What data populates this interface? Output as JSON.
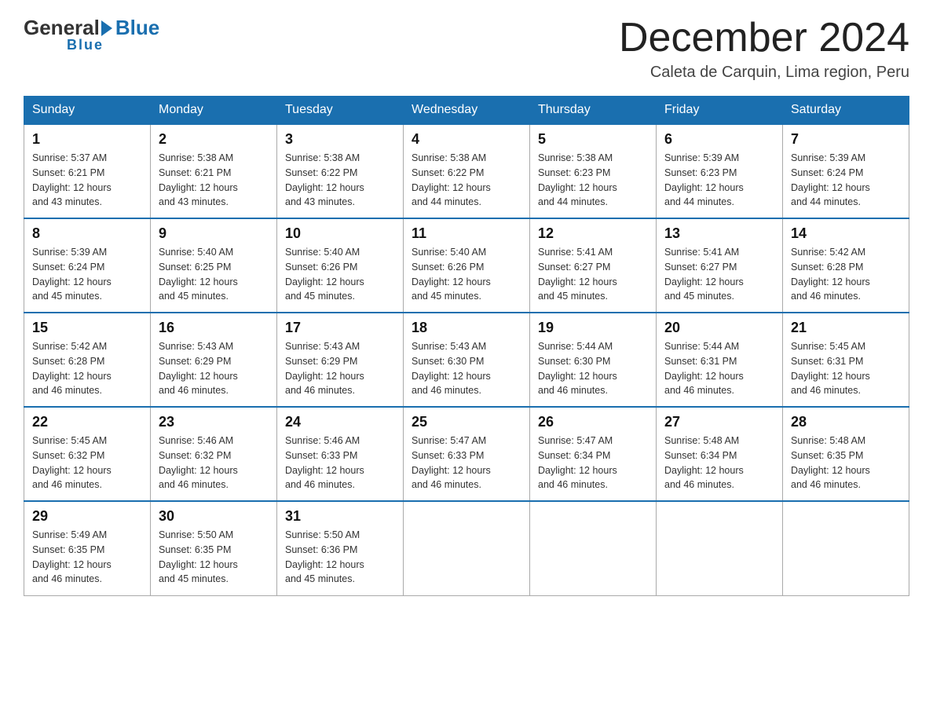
{
  "header": {
    "logo_general": "General",
    "logo_blue": "Blue",
    "month_title": "December 2024",
    "location": "Caleta de Carquin, Lima region, Peru"
  },
  "days_of_week": [
    "Sunday",
    "Monday",
    "Tuesday",
    "Wednesday",
    "Thursday",
    "Friday",
    "Saturday"
  ],
  "weeks": [
    [
      {
        "day": "1",
        "sunrise": "5:37 AM",
        "sunset": "6:21 PM",
        "daylight": "12 hours and 43 minutes."
      },
      {
        "day": "2",
        "sunrise": "5:38 AM",
        "sunset": "6:21 PM",
        "daylight": "12 hours and 43 minutes."
      },
      {
        "day": "3",
        "sunrise": "5:38 AM",
        "sunset": "6:22 PM",
        "daylight": "12 hours and 43 minutes."
      },
      {
        "day": "4",
        "sunrise": "5:38 AM",
        "sunset": "6:22 PM",
        "daylight": "12 hours and 44 minutes."
      },
      {
        "day": "5",
        "sunrise": "5:38 AM",
        "sunset": "6:23 PM",
        "daylight": "12 hours and 44 minutes."
      },
      {
        "day": "6",
        "sunrise": "5:39 AM",
        "sunset": "6:23 PM",
        "daylight": "12 hours and 44 minutes."
      },
      {
        "day": "7",
        "sunrise": "5:39 AM",
        "sunset": "6:24 PM",
        "daylight": "12 hours and 44 minutes."
      }
    ],
    [
      {
        "day": "8",
        "sunrise": "5:39 AM",
        "sunset": "6:24 PM",
        "daylight": "12 hours and 45 minutes."
      },
      {
        "day": "9",
        "sunrise": "5:40 AM",
        "sunset": "6:25 PM",
        "daylight": "12 hours and 45 minutes."
      },
      {
        "day": "10",
        "sunrise": "5:40 AM",
        "sunset": "6:26 PM",
        "daylight": "12 hours and 45 minutes."
      },
      {
        "day": "11",
        "sunrise": "5:40 AM",
        "sunset": "6:26 PM",
        "daylight": "12 hours and 45 minutes."
      },
      {
        "day": "12",
        "sunrise": "5:41 AM",
        "sunset": "6:27 PM",
        "daylight": "12 hours and 45 minutes."
      },
      {
        "day": "13",
        "sunrise": "5:41 AM",
        "sunset": "6:27 PM",
        "daylight": "12 hours and 45 minutes."
      },
      {
        "day": "14",
        "sunrise": "5:42 AM",
        "sunset": "6:28 PM",
        "daylight": "12 hours and 46 minutes."
      }
    ],
    [
      {
        "day": "15",
        "sunrise": "5:42 AM",
        "sunset": "6:28 PM",
        "daylight": "12 hours and 46 minutes."
      },
      {
        "day": "16",
        "sunrise": "5:43 AM",
        "sunset": "6:29 PM",
        "daylight": "12 hours and 46 minutes."
      },
      {
        "day": "17",
        "sunrise": "5:43 AM",
        "sunset": "6:29 PM",
        "daylight": "12 hours and 46 minutes."
      },
      {
        "day": "18",
        "sunrise": "5:43 AM",
        "sunset": "6:30 PM",
        "daylight": "12 hours and 46 minutes."
      },
      {
        "day": "19",
        "sunrise": "5:44 AM",
        "sunset": "6:30 PM",
        "daylight": "12 hours and 46 minutes."
      },
      {
        "day": "20",
        "sunrise": "5:44 AM",
        "sunset": "6:31 PM",
        "daylight": "12 hours and 46 minutes."
      },
      {
        "day": "21",
        "sunrise": "5:45 AM",
        "sunset": "6:31 PM",
        "daylight": "12 hours and 46 minutes."
      }
    ],
    [
      {
        "day": "22",
        "sunrise": "5:45 AM",
        "sunset": "6:32 PM",
        "daylight": "12 hours and 46 minutes."
      },
      {
        "day": "23",
        "sunrise": "5:46 AM",
        "sunset": "6:32 PM",
        "daylight": "12 hours and 46 minutes."
      },
      {
        "day": "24",
        "sunrise": "5:46 AM",
        "sunset": "6:33 PM",
        "daylight": "12 hours and 46 minutes."
      },
      {
        "day": "25",
        "sunrise": "5:47 AM",
        "sunset": "6:33 PM",
        "daylight": "12 hours and 46 minutes."
      },
      {
        "day": "26",
        "sunrise": "5:47 AM",
        "sunset": "6:34 PM",
        "daylight": "12 hours and 46 minutes."
      },
      {
        "day": "27",
        "sunrise": "5:48 AM",
        "sunset": "6:34 PM",
        "daylight": "12 hours and 46 minutes."
      },
      {
        "day": "28",
        "sunrise": "5:48 AM",
        "sunset": "6:35 PM",
        "daylight": "12 hours and 46 minutes."
      }
    ],
    [
      {
        "day": "29",
        "sunrise": "5:49 AM",
        "sunset": "6:35 PM",
        "daylight": "12 hours and 46 minutes."
      },
      {
        "day": "30",
        "sunrise": "5:50 AM",
        "sunset": "6:35 PM",
        "daylight": "12 hours and 45 minutes."
      },
      {
        "day": "31",
        "sunrise": "5:50 AM",
        "sunset": "6:36 PM",
        "daylight": "12 hours and 45 minutes."
      },
      null,
      null,
      null,
      null
    ]
  ],
  "labels": {
    "sunrise": "Sunrise:",
    "sunset": "Sunset:",
    "daylight": "Daylight:"
  }
}
